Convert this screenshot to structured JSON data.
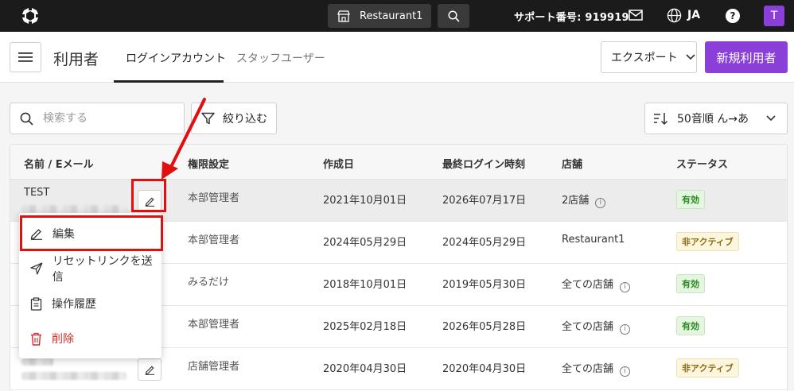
{
  "topbar": {
    "store": "Restaurant1",
    "support": "サポート番号: 919919",
    "lang": "JA",
    "help": "?",
    "avatar": "T"
  },
  "header": {
    "title": "利用者",
    "tabs": [
      "ログインアカウント",
      "スタッフユーザー"
    ],
    "export_label": "エクスポート",
    "new_label": "新規利用者"
  },
  "filters": {
    "search_placeholder": "検索する",
    "filter_label": "絞り込む",
    "sort_label": "50音順 ん→あ"
  },
  "table": {
    "columns": [
      "名前 / Eメール",
      "権限設定",
      "作成日",
      "最終ログイン時刻",
      "店舗",
      "ステータス"
    ],
    "rows": [
      {
        "name": "TEST",
        "role": "本部管理者",
        "created": "2021年10月01日",
        "last_login": "2026年07月17日",
        "store": "2店舗",
        "store_info": true,
        "status": "有効"
      },
      {
        "name": "",
        "role": "本部管理者",
        "created": "2024年05月29日",
        "last_login": "2024年05月29日",
        "store": "Restaurant1",
        "store_info": false,
        "status": "非アクティブ"
      },
      {
        "name": "",
        "role": "みるだけ",
        "created": "2018年10月01日",
        "last_login": "2019年05月30日",
        "store": "全ての店舗",
        "store_info": true,
        "status": "有効"
      },
      {
        "name": "",
        "role": "本部管理者",
        "created": "2025年02月18日",
        "last_login": "2026年05月28日",
        "store": "全ての店舗",
        "store_info": true,
        "status": "有効"
      },
      {
        "name": "",
        "role": "店舗管理者",
        "created": "2020年04月30日",
        "last_login": "2020年04月30日",
        "store": "全ての店舗",
        "store_info": true,
        "status": "非アクティブ"
      }
    ]
  },
  "menu": {
    "items": [
      "編集",
      "リセットリンクを送信",
      "操作履歴",
      "削除"
    ]
  },
  "colors": {
    "accent": "#8b3fd9",
    "annotation": "#e01010",
    "danger": "#d32f2f"
  }
}
